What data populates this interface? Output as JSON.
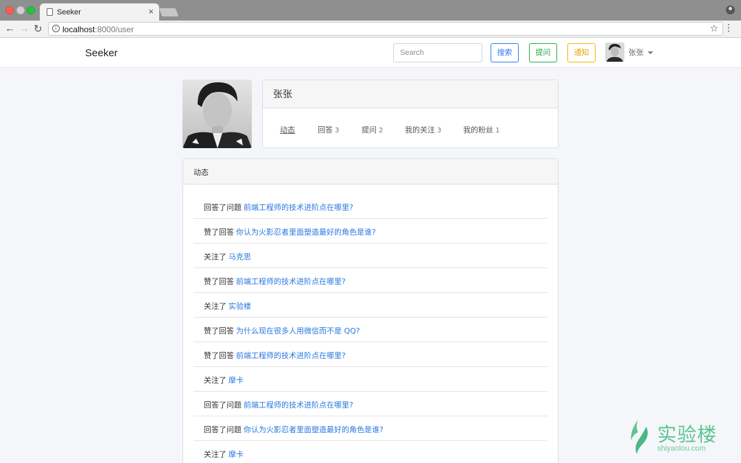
{
  "browser": {
    "tab_title": "Seeker",
    "url_host": "localhost",
    "url_path": ":8000/user",
    "close_glyph": "×"
  },
  "header": {
    "brand": "Seeker",
    "search_placeholder": "Search",
    "search_button": "搜索",
    "ask_button": "提问",
    "notify_button": "通知",
    "username": "张张"
  },
  "profile": {
    "name": "张张",
    "tabs": [
      {
        "label": "动态",
        "count": ""
      },
      {
        "label": "回答",
        "count": "3"
      },
      {
        "label": "提问",
        "count": "2"
      },
      {
        "label": "我的关注",
        "count": "3"
      },
      {
        "label": "我的粉丝",
        "count": "1"
      }
    ]
  },
  "activity": {
    "title": "动态",
    "items": [
      {
        "action": "回答了问题",
        "target": "前端工程师的技术进阶点在哪里?"
      },
      {
        "action": "赞了回答",
        "target": "你认为火影忍者里面塑造最好的角色是谁?"
      },
      {
        "action": "关注了",
        "target": "马克思"
      },
      {
        "action": "赞了回答",
        "target": "前端工程师的技术进阶点在哪里?"
      },
      {
        "action": "关注了",
        "target": "实验楼"
      },
      {
        "action": "赞了回答",
        "target": "为什么现在很多人用微信而不是 QQ?"
      },
      {
        "action": "赞了回答",
        "target": "前端工程师的技术进阶点在哪里?"
      },
      {
        "action": "关注了",
        "target": "摩卡"
      },
      {
        "action": "回答了问题",
        "target": "前端工程师的技术进阶点在哪里?"
      },
      {
        "action": "回答了问题",
        "target": "你认为火影忍者里面塑造最好的角色是谁?"
      },
      {
        "action": "关注了",
        "target": "摩卡"
      }
    ]
  },
  "watermark": {
    "name": "实验楼",
    "domain": "shiyanlou.com"
  },
  "colors": {
    "link": "#2878e0",
    "primary": "#2f7bf5",
    "success": "#28a745",
    "warning": "#f0b400"
  }
}
